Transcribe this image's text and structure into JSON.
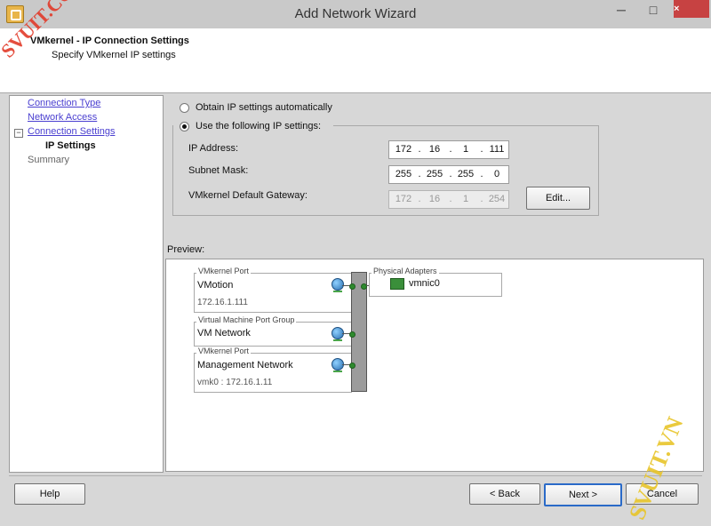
{
  "window": {
    "title": "Add Network Wizard",
    "minimize": "─",
    "maximize": "□",
    "close": "×"
  },
  "header": {
    "title": "VMkernel - IP Connection Settings",
    "subtitle": "Specify VMkernel IP settings"
  },
  "nav": {
    "items": [
      {
        "label": "Connection Type",
        "state": "link"
      },
      {
        "label": "Network Access",
        "state": "link"
      },
      {
        "label": "Connection Settings",
        "state": "link"
      },
      {
        "label": "IP Settings",
        "state": "current"
      },
      {
        "label": "Summary",
        "state": "disabled"
      }
    ],
    "collapse_glyph": "−"
  },
  "ip_settings": {
    "obtain_auto_label": "Obtain IP settings automatically",
    "use_following_label": "Use the following IP settings:",
    "selected": "use_following",
    "ip_address": {
      "label": "IP Address:",
      "octets": [
        "172",
        "16",
        "1",
        "111"
      ]
    },
    "subnet_mask": {
      "label": "Subnet Mask:",
      "octets": [
        "255",
        "255",
        "255",
        "0"
      ]
    },
    "gateway": {
      "label": "VMkernel Default Gateway:",
      "octets": [
        "172",
        "16",
        "1",
        "254"
      ],
      "disabled": true
    },
    "edit_button": "Edit...",
    "dot": "."
  },
  "preview": {
    "label": "Preview:",
    "port_groups": [
      {
        "legend": "VMkernel Port",
        "name": "VMotion",
        "detail": "172.16.1.111"
      },
      {
        "legend": "Virtual Machine Port Group",
        "name": "VM Network",
        "detail": ""
      },
      {
        "legend": "VMkernel Port",
        "name": "Management Network",
        "detail": "vmk0 : 172.16.1.11"
      }
    ],
    "physical_adapters": {
      "legend": "Physical Adapters",
      "nic": "vmnic0"
    }
  },
  "footer": {
    "help": "Help",
    "back": "< Back",
    "next": "Next >",
    "cancel": "Cancel"
  },
  "watermarks": [
    "SVUIT.COM",
    "SVUIT.VN"
  ],
  "colors": {
    "link": "#4a3fd0",
    "watermark": "#e23b2a",
    "close": "#c74242"
  }
}
